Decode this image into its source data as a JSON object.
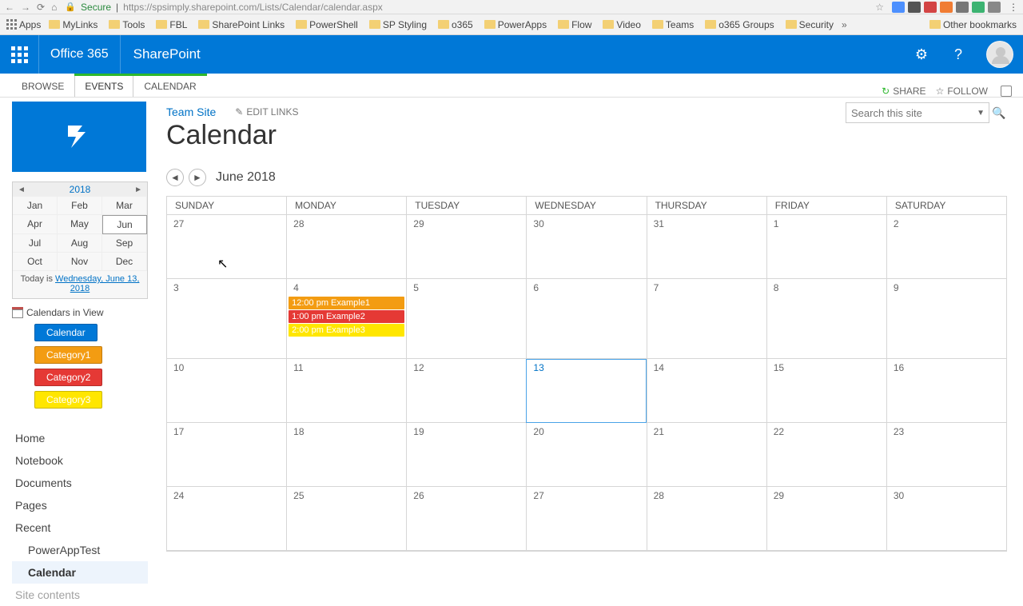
{
  "browser": {
    "secure_label": "Secure",
    "url": "https://spsimply.sharepoint.com/Lists/Calendar/calendar.aspx"
  },
  "bookmarks": {
    "apps": "Apps",
    "items": [
      "MyLinks",
      "Tools",
      "FBL",
      "SharePoint Links",
      "PowerShell",
      "SP Styling",
      "o365",
      "PowerApps",
      "Flow",
      "Video",
      "Teams",
      "o365 Groups",
      "Security"
    ],
    "overflow": "»",
    "other": "Other bookmarks"
  },
  "suite": {
    "product": "Office 365",
    "app": "SharePoint"
  },
  "ribbon": {
    "browse": "BROWSE",
    "events": "EVENTS",
    "calendar": "CALENDAR",
    "share": "SHARE",
    "follow": "FOLLOW"
  },
  "breadcrumb": {
    "site": "Team Site",
    "edit": "EDIT LINKS"
  },
  "title": "Calendar",
  "search": {
    "placeholder": "Search this site"
  },
  "miniCal": {
    "year": "2018",
    "months": [
      "Jan",
      "Feb",
      "Mar",
      "Apr",
      "May",
      "Jun",
      "Jul",
      "Aug",
      "Sep",
      "Oct",
      "Nov",
      "Dec"
    ],
    "selected": "Jun",
    "today_prefix": "Today is ",
    "today_link": "Wednesday, June 13, 2018"
  },
  "civ": {
    "label": "Calendars in View",
    "chips": [
      "Calendar",
      "Category1",
      "Category2",
      "Category3"
    ]
  },
  "colors": {
    "chips": [
      "#0078d7",
      "#f39c12",
      "#e53935",
      "#ffe600"
    ]
  },
  "leftnav": {
    "items": [
      "Home",
      "Notebook",
      "Documents",
      "Pages",
      "Recent"
    ],
    "recent": [
      "PowerAppTest",
      "Calendar"
    ],
    "last": "Site contents",
    "selected": "Calendar"
  },
  "monthLabel": "June 2018",
  "dow": [
    "SUNDAY",
    "MONDAY",
    "TUESDAY",
    "WEDNESDAY",
    "THURSDAY",
    "FRIDAY",
    "SATURDAY"
  ],
  "days": [
    27,
    28,
    29,
    30,
    31,
    1,
    2,
    3,
    4,
    5,
    6,
    7,
    8,
    9,
    10,
    11,
    12,
    13,
    14,
    15,
    16,
    17,
    18,
    19,
    20,
    21,
    22,
    23,
    24,
    25,
    26,
    27,
    28,
    29,
    30
  ],
  "todayIndex": 17,
  "events": {
    "dayIndex": 8,
    "items": [
      {
        "label": "12:00 pm Example1",
        "cls": "ev-orange"
      },
      {
        "label": "1:00 pm Example2",
        "cls": "ev-red"
      },
      {
        "label": "2:00 pm Example3",
        "cls": "ev-yellow"
      }
    ]
  }
}
